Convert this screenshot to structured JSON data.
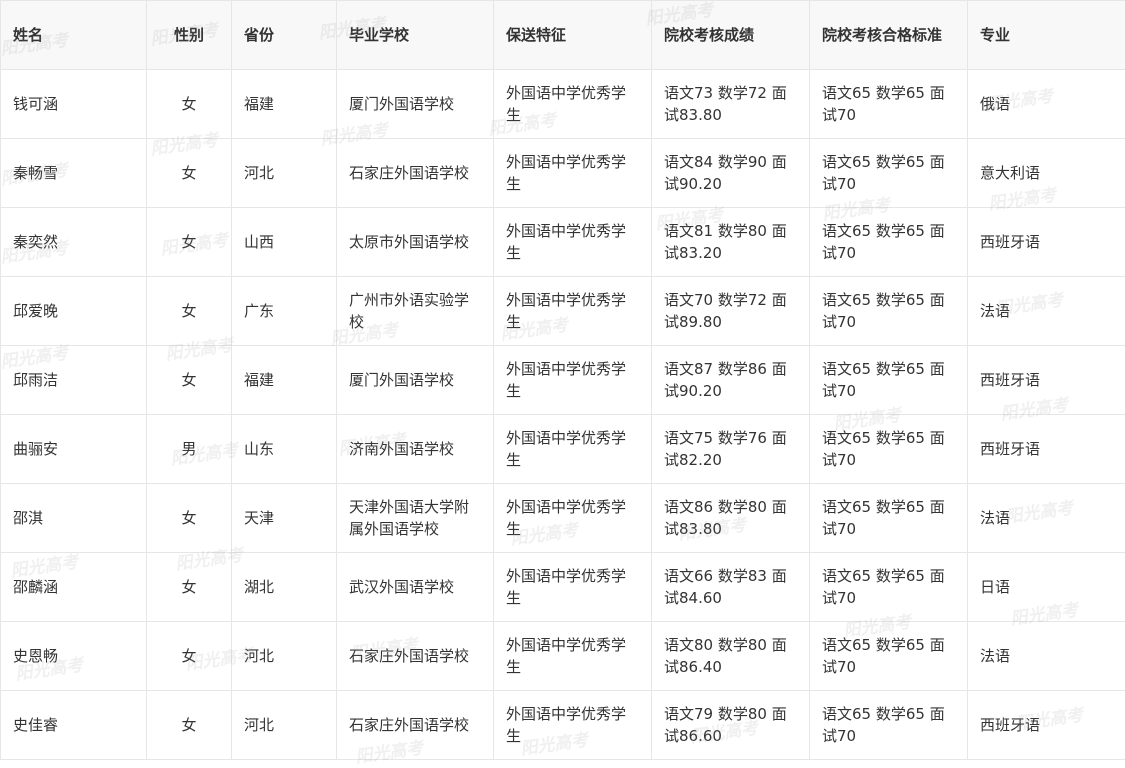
{
  "table": {
    "headers": [
      "姓名",
      "性别",
      "省份",
      "毕业学校",
      "保送特征",
      "院校考核成绩",
      "院校考核合格标准",
      "专业"
    ],
    "rows": [
      [
        "钱可涵",
        "女",
        "福建",
        "厦门外国语学校",
        "外国语中学优秀学生",
        "语文73 数学72 面试83.80",
        "语文65 数学65 面试70",
        "俄语"
      ],
      [
        "秦畅雪",
        "女",
        "河北",
        "石家庄外国语学校",
        "外国语中学优秀学生",
        "语文84 数学90 面试90.20",
        "语文65 数学65 面试70",
        "意大利语"
      ],
      [
        "秦奕然",
        "女",
        "山西",
        "太原市外国语学校",
        "外国语中学优秀学生",
        "语文81 数学80 面试83.20",
        "语文65 数学65 面试70",
        "西班牙语"
      ],
      [
        "邱爱晚",
        "女",
        "广东",
        "广州市外语实验学校",
        "外国语中学优秀学生",
        "语文70 数学72 面试89.80",
        "语文65 数学65 面试70",
        "法语"
      ],
      [
        "邱雨洁",
        "女",
        "福建",
        "厦门外国语学校",
        "外国语中学优秀学生",
        "语文87 数学86 面试90.20",
        "语文65 数学65 面试70",
        "西班牙语"
      ],
      [
        "曲骊安",
        "男",
        "山东",
        "济南外国语学校",
        "外国语中学优秀学生",
        "语文75 数学76 面试82.20",
        "语文65 数学65 面试70",
        "西班牙语"
      ],
      [
        "邵淇",
        "女",
        "天津",
        "天津外国语大学附属外国语学校",
        "外国语中学优秀学生",
        "语文86 数学80 面试83.80",
        "语文65 数学65 面试70",
        "法语"
      ],
      [
        "邵麟涵",
        "女",
        "湖北",
        "武汉外国语学校",
        "外国语中学优秀学生",
        "语文66 数学83 面试84.60",
        "语文65 数学65 面试70",
        "日语"
      ],
      [
        "史恩畅",
        "女",
        "河北",
        "石家庄外国语学校",
        "外国语中学优秀学生",
        "语文80 数学80 面试86.40",
        "语文65 数学65 面试70",
        "法语"
      ],
      [
        "史佳睿",
        "女",
        "河北",
        "石家庄外国语学校",
        "外国语中学优秀学生",
        "语文79 数学80 面试86.60",
        "语文65 数学65 面试70",
        "西班牙语"
      ]
    ]
  },
  "watermark": {
    "text": "阳光高考"
  }
}
